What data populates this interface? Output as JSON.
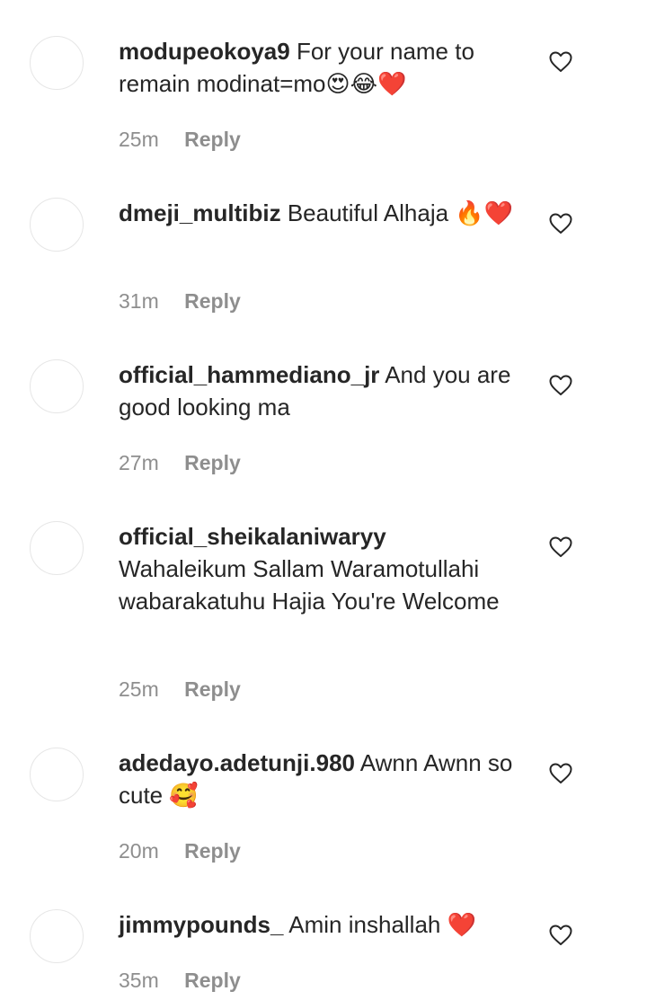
{
  "comments": [
    {
      "username": "modupeokoya9",
      "text": "For your name to remain modinat=mo😍😂❤️",
      "time": "25m",
      "reply_label": "Reply"
    },
    {
      "username": "dmeji_multibiz",
      "text": "Beautiful Alhaja 🔥❤️",
      "time": "31m",
      "reply_label": "Reply"
    },
    {
      "username": "official_hammediano_jr",
      "text": "And you are good looking ma",
      "time": "27m",
      "reply_label": "Reply"
    },
    {
      "username": "official_sheikalaniwaryy",
      "text": "Wahaleikum Sallam Waramotullahi wabarakatuhu Hajia You're Welcome",
      "time": "25m",
      "reply_label": "Reply"
    },
    {
      "username": "adedayo.adetunji.980",
      "text": "Awnn Awnn so cute 🥰",
      "time": "20m",
      "reply_label": "Reply"
    },
    {
      "username": "jimmypounds_",
      "text": "Amin inshallah ❤️",
      "time": "35m",
      "reply_label": "Reply"
    }
  ],
  "colors": {
    "username": "#262626",
    "body_text": "#262626",
    "meta_text": "#8e8e8e",
    "avatar_border": "#e6e6e6",
    "heart_stroke": "#262626"
  },
  "icons": {
    "like": "heart-outline-icon"
  }
}
